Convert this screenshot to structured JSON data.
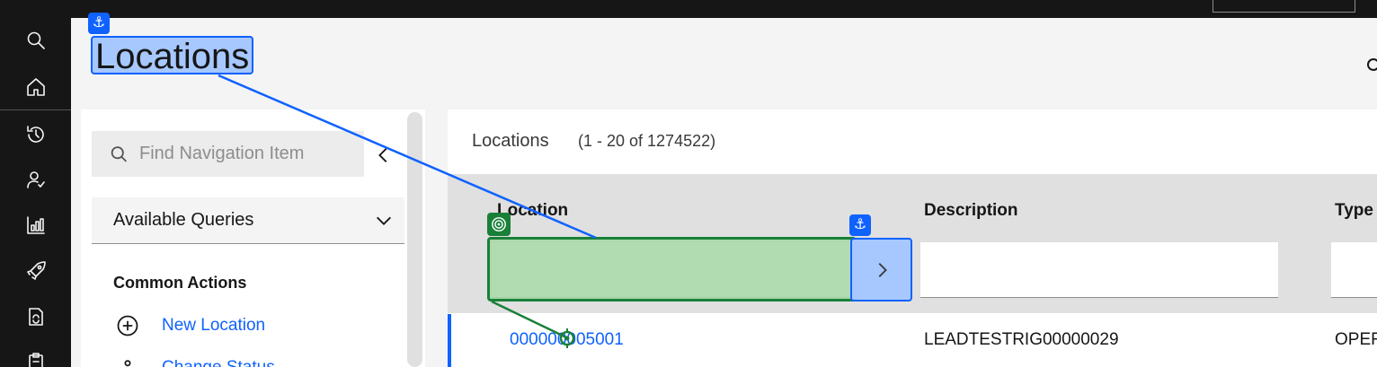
{
  "page": {
    "title": "Locations"
  },
  "rail": {
    "items": [
      {
        "icon": "search-icon"
      },
      {
        "icon": "home-icon"
      },
      {
        "icon": "history-icon"
      },
      {
        "icon": "user-check-icon"
      },
      {
        "icon": "chart-icon"
      },
      {
        "icon": "rocket-icon"
      },
      {
        "icon": "refresh-doc-icon"
      },
      {
        "icon": "clipboard-icon"
      }
    ]
  },
  "nav": {
    "search_placeholder": "Find Navigation Item",
    "queries_label": "Available Queries",
    "common_actions_heading": "Common Actions",
    "actions": [
      {
        "label": "New Location",
        "icon": "add-circle-icon"
      },
      {
        "label": "Change Status",
        "icon": "status-icon"
      }
    ]
  },
  "table": {
    "title": "Locations",
    "count": "(1 - 20 of 1274522)",
    "columns": [
      "Location",
      "Description",
      "Type"
    ],
    "rows": [
      {
        "location": "000000005001",
        "description": "LEADTESTRIG00000029",
        "type": "OPER"
      }
    ]
  },
  "annotations": {
    "anchor_glyph": "⚓",
    "colors": {
      "anchor": "#0f62fe",
      "target": "#198038"
    }
  }
}
